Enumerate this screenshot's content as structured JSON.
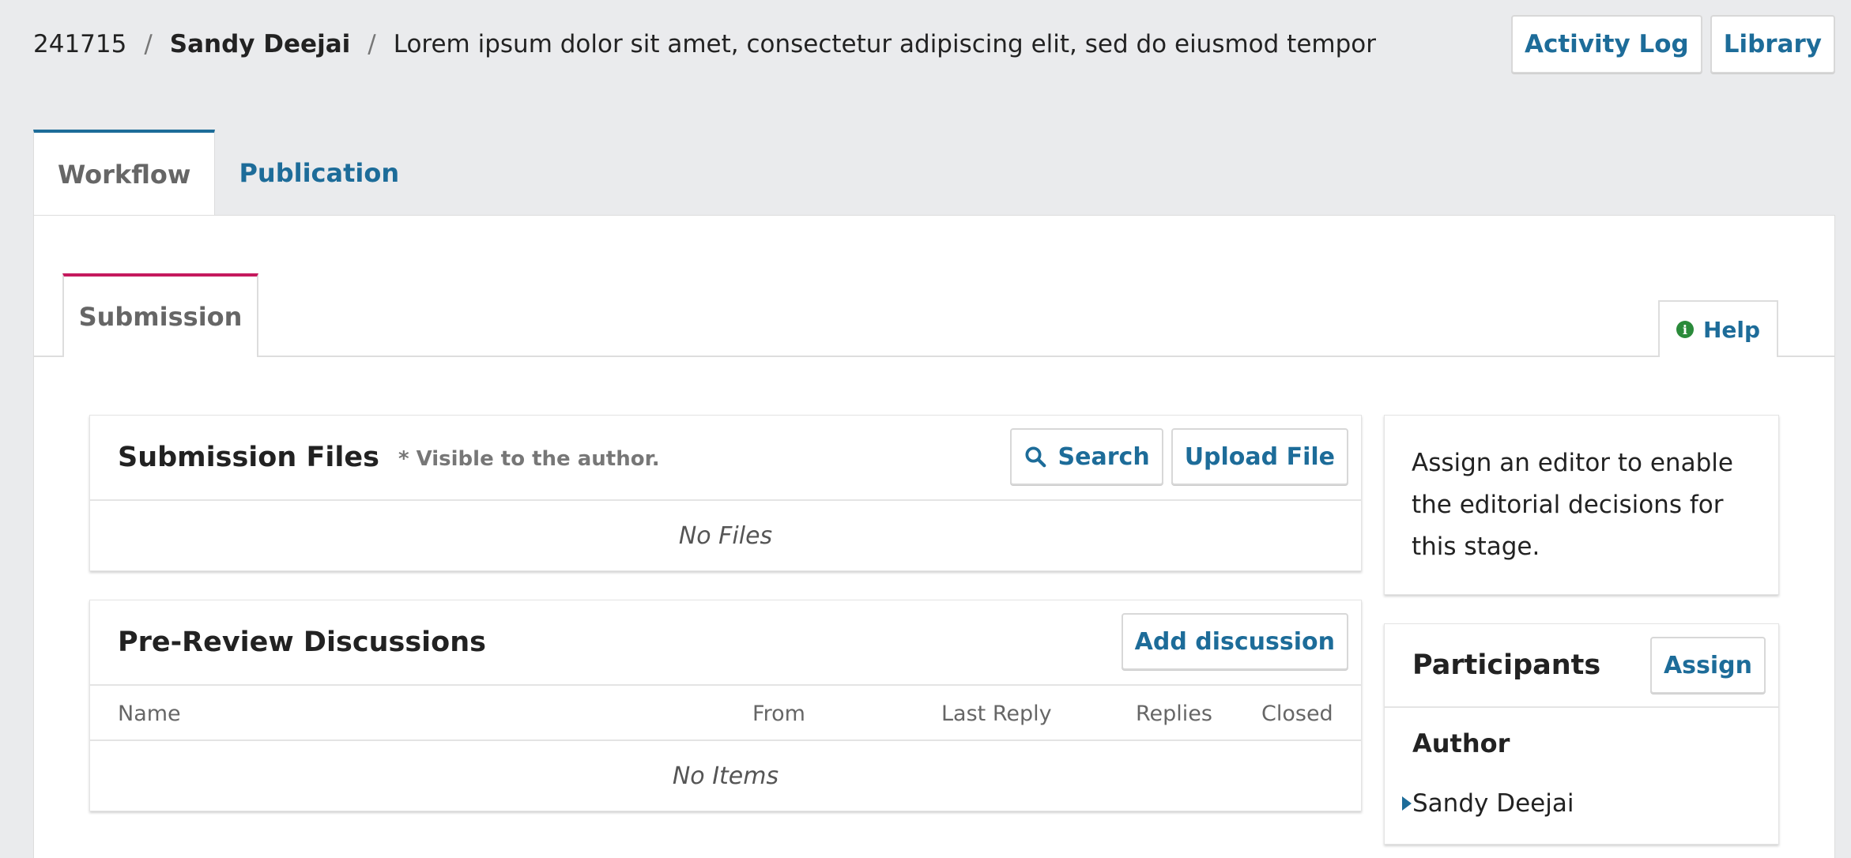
{
  "breadcrumb": {
    "id": "241715",
    "separator": "/",
    "author": "Sandy Deejai",
    "title": "Lorem ipsum dolor sit amet, consectetur adipiscing elit, sed do eiusmod tempor"
  },
  "top_actions": {
    "activity_log": "Activity Log",
    "library": "Library"
  },
  "main_tabs": [
    {
      "label": "Workflow",
      "active": true
    },
    {
      "label": "Publication",
      "active": false
    }
  ],
  "stage_tabs": [
    {
      "label": "Submission",
      "active": true
    }
  ],
  "help": {
    "label": "Help",
    "icon": "info-icon"
  },
  "submission_files": {
    "title": "Submission Files",
    "note": "* Visible to the author.",
    "search_label": "Search",
    "upload_label": "Upload File",
    "empty": "No Files"
  },
  "discussions": {
    "title": "Pre-Review Discussions",
    "add_label": "Add discussion",
    "columns": [
      "Name",
      "From",
      "Last Reply",
      "Replies",
      "Closed"
    ],
    "empty": "No Items"
  },
  "editor_notice": "Assign an editor to enable the editorial decisions for this stage.",
  "participants": {
    "title": "Participants",
    "assign_label": "Assign",
    "groups": [
      {
        "role": "Author",
        "members": [
          "Sandy Deejai"
        ]
      }
    ]
  },
  "colors": {
    "accent": "#1d6c99",
    "stage_accent": "#c5195d",
    "help_icon": "#2a8a3a",
    "background": "#eaebed"
  }
}
